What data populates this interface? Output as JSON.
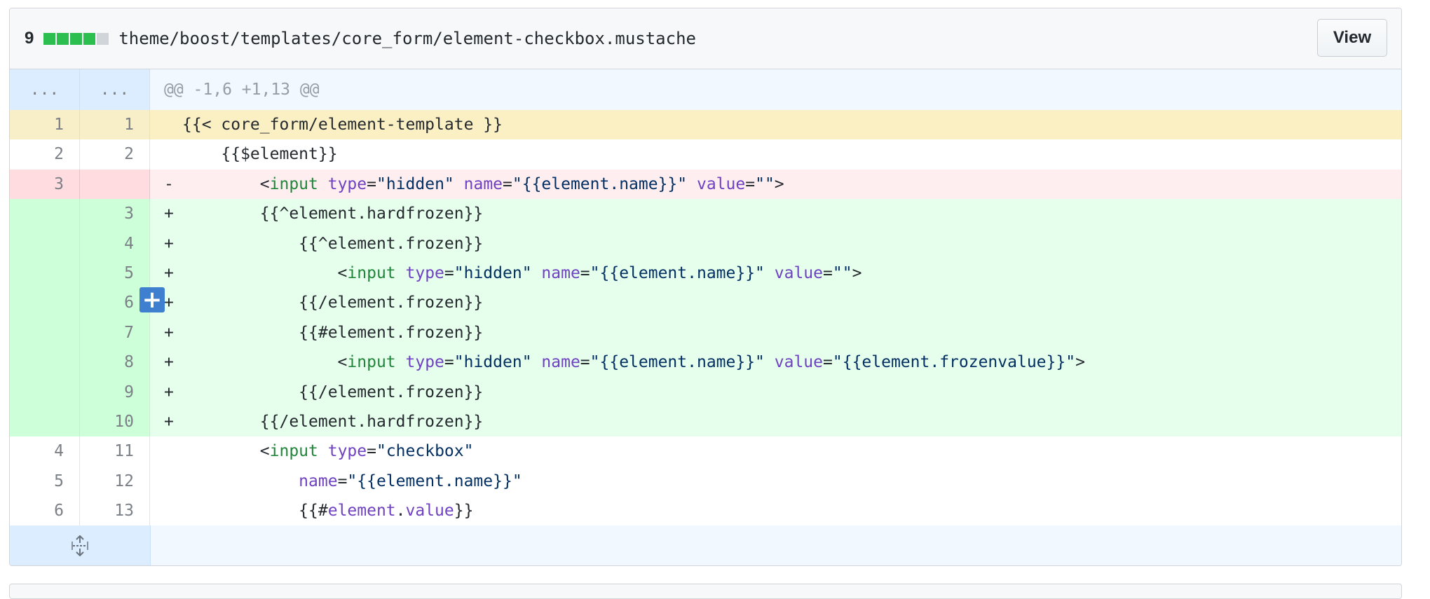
{
  "file": {
    "diffstat": "9",
    "path": "theme/boost/templates/core_form/element-checkbox.mustache",
    "view_label": "View"
  },
  "hunk": {
    "left": "...",
    "right": "...",
    "header": "@@ -1,6 +1,13 @@"
  },
  "lines": [
    {
      "type": "hl",
      "old": "1",
      "new": "1",
      "marker": "",
      "segments": [
        {
          "t": "{{< core_form/element-template }}",
          "c": ""
        }
      ]
    },
    {
      "type": "ctx",
      "old": "2",
      "new": "2",
      "marker": "",
      "segments": [
        {
          "t": "    {{$element}}",
          "c": ""
        }
      ]
    },
    {
      "type": "del",
      "old": "3",
      "new": "",
      "marker": "-",
      "segments": [
        {
          "t": "        <",
          "c": ""
        },
        {
          "t": "input",
          "c": "tag"
        },
        {
          "t": " ",
          "c": ""
        },
        {
          "t": "type",
          "c": "attr"
        },
        {
          "t": "=",
          "c": ""
        },
        {
          "t": "\"hidden\"",
          "c": "str"
        },
        {
          "t": " ",
          "c": ""
        },
        {
          "t": "name",
          "c": "attr"
        },
        {
          "t": "=",
          "c": ""
        },
        {
          "t": "\"{{element.name}}\"",
          "c": "str"
        },
        {
          "t": " ",
          "c": ""
        },
        {
          "t": "value",
          "c": "attr"
        },
        {
          "t": "=",
          "c": ""
        },
        {
          "t": "\"\"",
          "c": "str"
        },
        {
          "t": ">",
          "c": ""
        }
      ]
    },
    {
      "type": "add",
      "old": "",
      "new": "3",
      "marker": "+",
      "segments": [
        {
          "t": "        {{^element.hardfrozen}}",
          "c": ""
        }
      ]
    },
    {
      "type": "add",
      "old": "",
      "new": "4",
      "marker": "+",
      "segments": [
        {
          "t": "            {{^element.frozen}}",
          "c": ""
        }
      ]
    },
    {
      "type": "add",
      "old": "",
      "new": "5",
      "marker": "+",
      "segments": [
        {
          "t": "                <",
          "c": ""
        },
        {
          "t": "input",
          "c": "tag"
        },
        {
          "t": " ",
          "c": ""
        },
        {
          "t": "type",
          "c": "attr"
        },
        {
          "t": "=",
          "c": ""
        },
        {
          "t": "\"hidden\"",
          "c": "str"
        },
        {
          "t": " ",
          "c": ""
        },
        {
          "t": "name",
          "c": "attr"
        },
        {
          "t": "=",
          "c": ""
        },
        {
          "t": "\"{{element.name}}\"",
          "c": "str"
        },
        {
          "t": " ",
          "c": ""
        },
        {
          "t": "value",
          "c": "attr"
        },
        {
          "t": "=",
          "c": ""
        },
        {
          "t": "\"\"",
          "c": "str"
        },
        {
          "t": ">",
          "c": ""
        }
      ]
    },
    {
      "type": "add",
      "old": "",
      "new": "6",
      "marker": "+",
      "segments": [
        {
          "t": "            {{/element.frozen}}",
          "c": ""
        }
      ]
    },
    {
      "type": "add",
      "old": "",
      "new": "7",
      "marker": "+",
      "segments": [
        {
          "t": "            {{#element.frozen}}",
          "c": ""
        }
      ]
    },
    {
      "type": "add",
      "old": "",
      "new": "8",
      "marker": "+",
      "segments": [
        {
          "t": "                <",
          "c": ""
        },
        {
          "t": "input",
          "c": "tag"
        },
        {
          "t": " ",
          "c": ""
        },
        {
          "t": "type",
          "c": "attr"
        },
        {
          "t": "=",
          "c": ""
        },
        {
          "t": "\"hidden\"",
          "c": "str"
        },
        {
          "t": " ",
          "c": ""
        },
        {
          "t": "name",
          "c": "attr"
        },
        {
          "t": "=",
          "c": ""
        },
        {
          "t": "\"{{element.name}}\"",
          "c": "str"
        },
        {
          "t": " ",
          "c": ""
        },
        {
          "t": "value",
          "c": "attr"
        },
        {
          "t": "=",
          "c": ""
        },
        {
          "t": "\"{{element.frozenvalue}}\"",
          "c": "str"
        },
        {
          "t": ">",
          "c": ""
        }
      ]
    },
    {
      "type": "add",
      "old": "",
      "new": "9",
      "marker": "+",
      "segments": [
        {
          "t": "            {{/element.frozen}}",
          "c": ""
        }
      ]
    },
    {
      "type": "add",
      "old": "",
      "new": "10",
      "marker": "+",
      "segments": [
        {
          "t": "        {{/element.hardfrozen}}",
          "c": ""
        }
      ]
    },
    {
      "type": "ctx",
      "old": "4",
      "new": "11",
      "marker": "",
      "segments": [
        {
          "t": "        <",
          "c": ""
        },
        {
          "t": "input",
          "c": "tag"
        },
        {
          "t": " ",
          "c": ""
        },
        {
          "t": "type",
          "c": "attr"
        },
        {
          "t": "=",
          "c": ""
        },
        {
          "t": "\"checkbox\"",
          "c": "str"
        }
      ]
    },
    {
      "type": "ctx",
      "old": "5",
      "new": "12",
      "marker": "",
      "segments": [
        {
          "t": "            ",
          "c": ""
        },
        {
          "t": "name",
          "c": "attr"
        },
        {
          "t": "=",
          "c": ""
        },
        {
          "t": "\"{{element.name}}\"",
          "c": "str"
        }
      ]
    },
    {
      "type": "ctx",
      "old": "6",
      "new": "13",
      "marker": "",
      "segments": [
        {
          "t": "            {{#",
          "c": ""
        },
        {
          "t": "element",
          "c": "attr"
        },
        {
          "t": ".",
          "c": ""
        },
        {
          "t": "value",
          "c": "attr"
        },
        {
          "t": "}}",
          "c": ""
        }
      ]
    }
  ],
  "icons": {
    "expand": "unfold-icon",
    "add_comment": "plus-icon"
  }
}
